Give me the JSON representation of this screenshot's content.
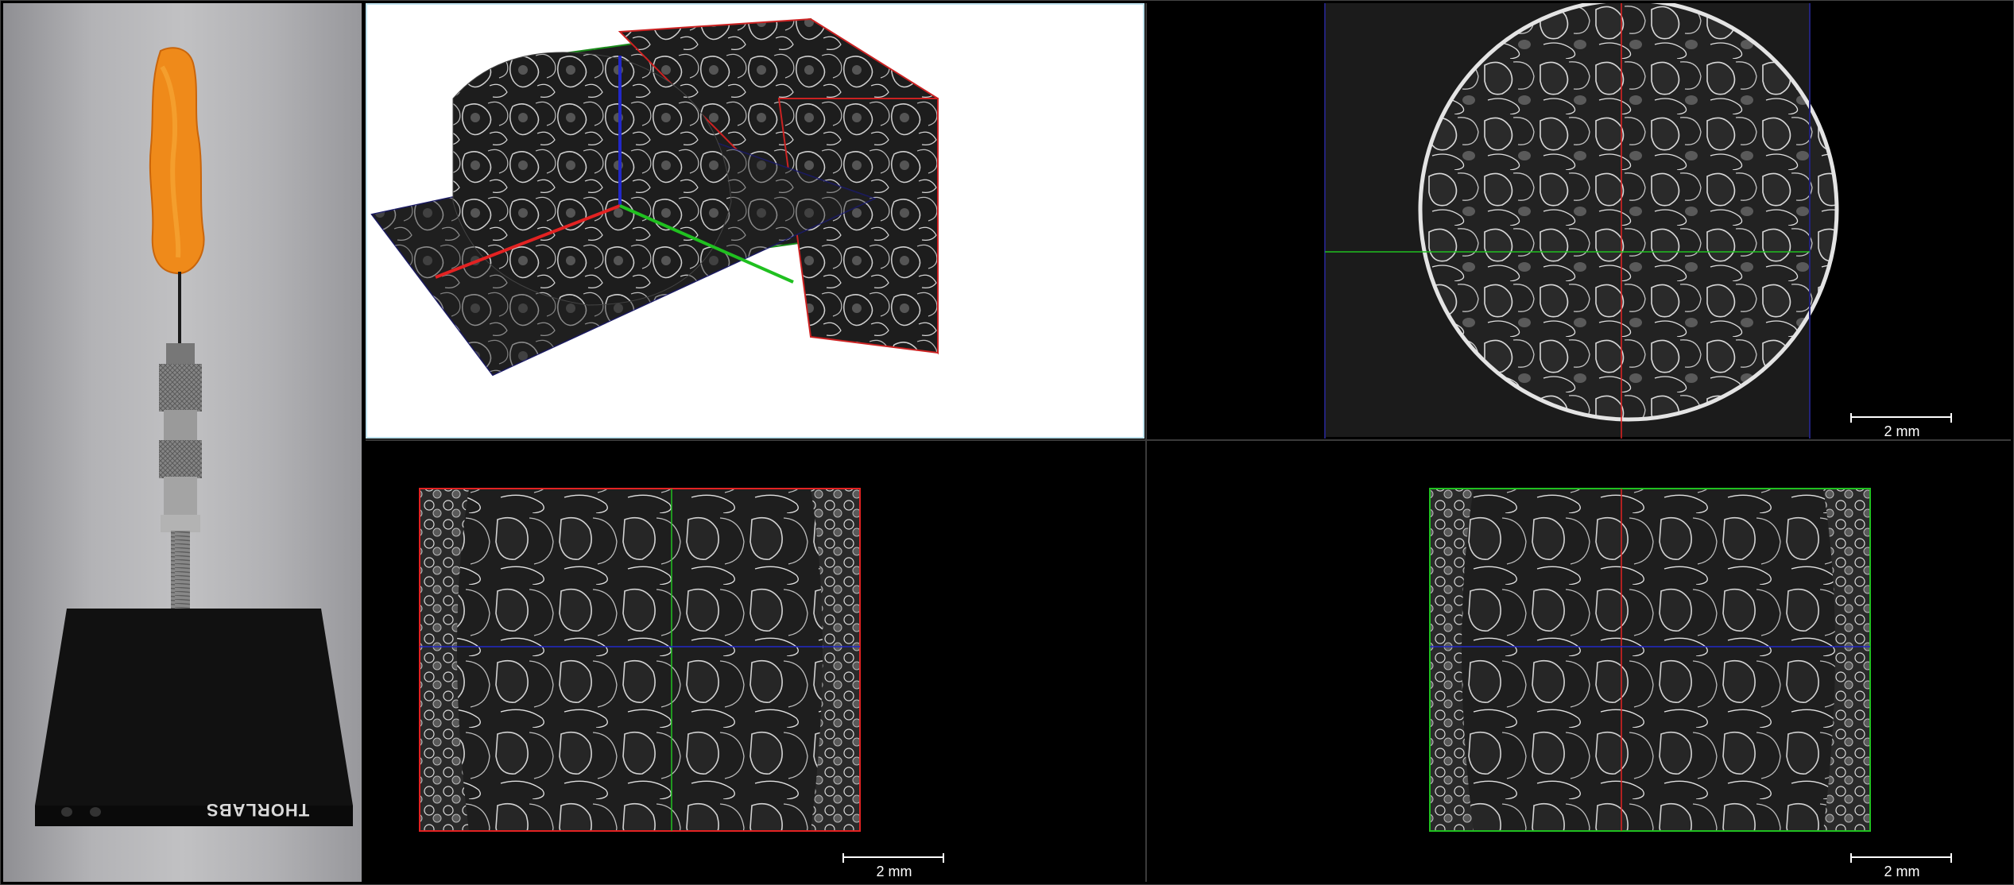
{
  "photo": {
    "brand_label": "THORLABS"
  },
  "views": {
    "view3d_name": "",
    "axial": {
      "scalebar": "2 mm"
    },
    "coronal": {
      "scalebar": "2 mm"
    },
    "sagittal": {
      "scalebar": "2 mm"
    }
  },
  "colors": {
    "axis_red": "#e32222",
    "axis_green": "#20c020",
    "axis_blue": "#2228c8",
    "snack_orange": "#f08a18",
    "background": "#000000"
  }
}
